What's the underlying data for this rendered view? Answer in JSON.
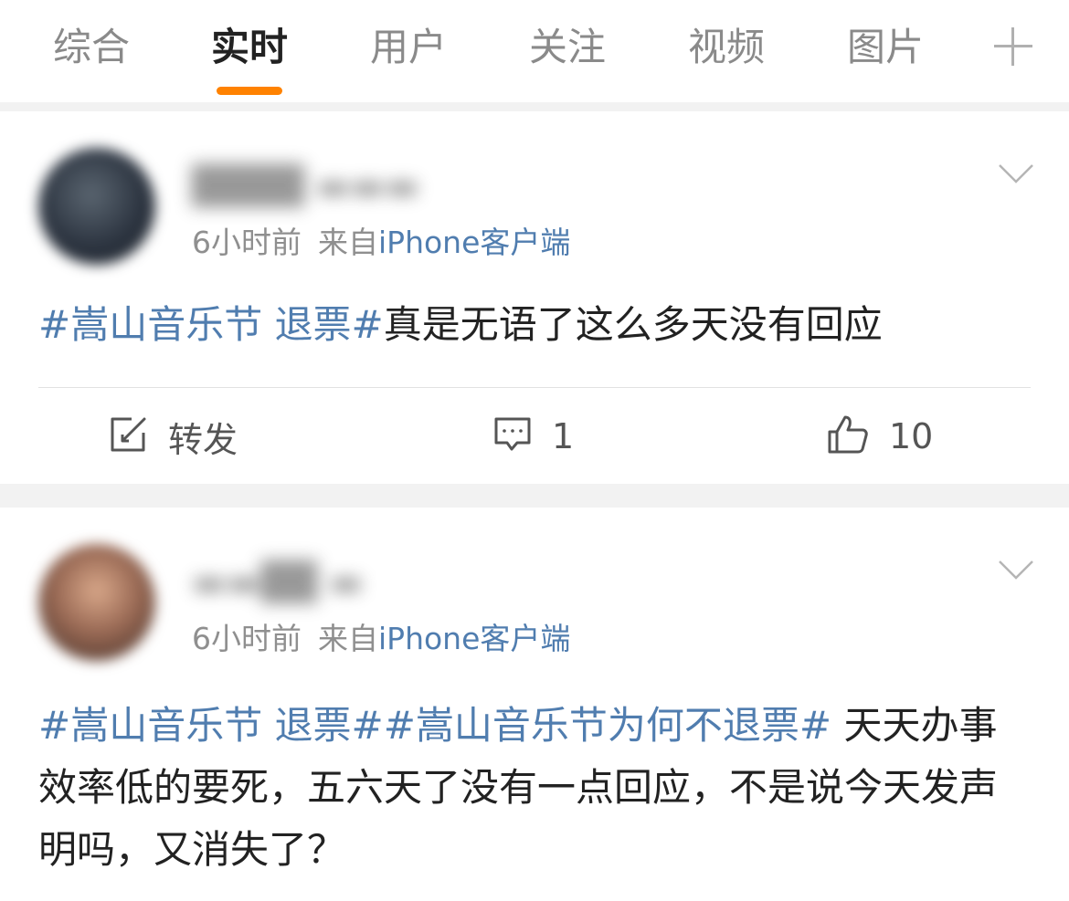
{
  "tabs": [
    {
      "label": "综合"
    },
    {
      "label": "实时"
    },
    {
      "label": "用户"
    },
    {
      "label": "关注"
    },
    {
      "label": "视频"
    },
    {
      "label": "图片"
    }
  ],
  "active_tab": "实时",
  "accent_color": "#ff8200",
  "link_color": "#507daf",
  "posts": [
    {
      "time": "6小时前",
      "from": "来自",
      "source": "iPhone客户端",
      "hashtags": [
        "#嵩山音乐节 退票#"
      ],
      "text": "真是无语了这么多天没有回应",
      "actions": {
        "repost_label": "转发",
        "comment_count": "1",
        "like_count": "10"
      }
    },
    {
      "time": "6小时前",
      "from": "来自",
      "source": "iPhone客户端",
      "hashtags": [
        "#嵩山音乐节 退票#",
        "#嵩山音乐节为何不退票#"
      ],
      "text": " 天天办事效率低的要死，五六天了没有一点回应，不是说今天发声明吗，又消失了？"
    }
  ]
}
